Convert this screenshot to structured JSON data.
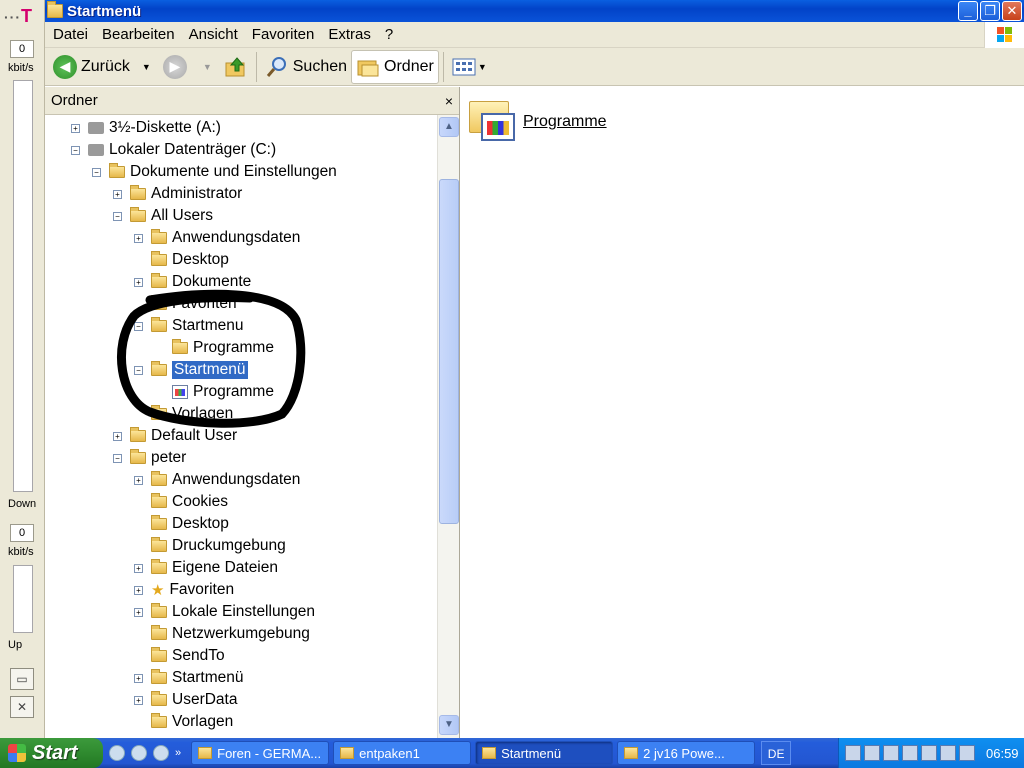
{
  "meter": {
    "logo": "T",
    "logo_dots": "···",
    "down_value": "0",
    "down_unit": "kbit/s",
    "down_label": "Down",
    "up_value": "0",
    "up_unit": "kbit/s",
    "up_label": "Up"
  },
  "window": {
    "title": "Startmenü",
    "menu": [
      "Datei",
      "Bearbeiten",
      "Ansicht",
      "Favoriten",
      "Extras",
      "?"
    ],
    "toolbar": {
      "back_label": "Zurück",
      "search_label": "Suchen",
      "folders_label": "Ordner"
    }
  },
  "folder_pane": {
    "header": "Ordner",
    "close": "×",
    "tree": [
      {
        "label": "3½-Diskette (A:)",
        "exp": "+",
        "icon": "floppy-icon"
      },
      {
        "label": "Lokaler Datenträger (C:)",
        "exp": "−",
        "icon": "drive-icon"
      },
      {
        "label": "Dokumente und Einstellungen",
        "exp": "−",
        "icon": "folder-icon"
      },
      {
        "label": "Administrator",
        "exp": "+",
        "icon": "folder-icon"
      },
      {
        "label": "All Users",
        "exp": "−",
        "icon": "folder-icon"
      },
      {
        "label": "Anwendungsdaten",
        "exp": "+",
        "icon": "folder-icon"
      },
      {
        "label": "Desktop",
        "exp": "",
        "icon": "folder-icon"
      },
      {
        "label": "Dokumente",
        "exp": "+",
        "icon": "folder-icon"
      },
      {
        "label": "Favoriten",
        "exp": "",
        "icon": "folder-icon"
      },
      {
        "label": "Startmenu",
        "exp": "−",
        "icon": "folder-icon"
      },
      {
        "label": "Programme",
        "exp": "",
        "icon": "folder-icon"
      },
      {
        "label": "Startmenü",
        "exp": "−",
        "icon": "folder-icon",
        "selected": true
      },
      {
        "label": "Programme",
        "exp": "",
        "icon": "programs-icon"
      },
      {
        "label": "Vorlagen",
        "exp": "",
        "icon": "folder-icon"
      },
      {
        "label": "Default User",
        "exp": "+",
        "icon": "folder-icon"
      },
      {
        "label": "peter",
        "exp": "−",
        "icon": "folder-icon"
      },
      {
        "label": "Anwendungsdaten",
        "exp": "+",
        "icon": "folder-icon"
      },
      {
        "label": "Cookies",
        "exp": "",
        "icon": "folder-icon"
      },
      {
        "label": "Desktop",
        "exp": "",
        "icon": "folder-icon"
      },
      {
        "label": "Druckumgebung",
        "exp": "",
        "icon": "folder-icon"
      },
      {
        "label": "Eigene Dateien",
        "exp": "+",
        "icon": "folder-icon"
      },
      {
        "label": "Favoriten",
        "exp": "+",
        "icon": "star-icon"
      },
      {
        "label": "Lokale Einstellungen",
        "exp": "+",
        "icon": "folder-icon"
      },
      {
        "label": "Netzwerkumgebung",
        "exp": "",
        "icon": "folder-icon"
      },
      {
        "label": "SendTo",
        "exp": "",
        "icon": "folder-icon"
      },
      {
        "label": "Startmenü",
        "exp": "+",
        "icon": "folder-icon"
      },
      {
        "label": "UserData",
        "exp": "+",
        "icon": "folder-icon"
      },
      {
        "label": "Vorlagen",
        "exp": "",
        "icon": "folder-icon"
      }
    ]
  },
  "right_pane": {
    "items": [
      {
        "label": "Programme",
        "icon": "programs-folder-icon"
      }
    ]
  },
  "taskbar": {
    "start_label": "Start",
    "tasks": [
      {
        "label": "Foren - GERMA..."
      },
      {
        "label": "entpaken1"
      },
      {
        "label": "Startmenü",
        "active": true
      },
      {
        "label": "2 jv16 Powe..."
      }
    ],
    "language": "DE",
    "clock": "06:59"
  }
}
